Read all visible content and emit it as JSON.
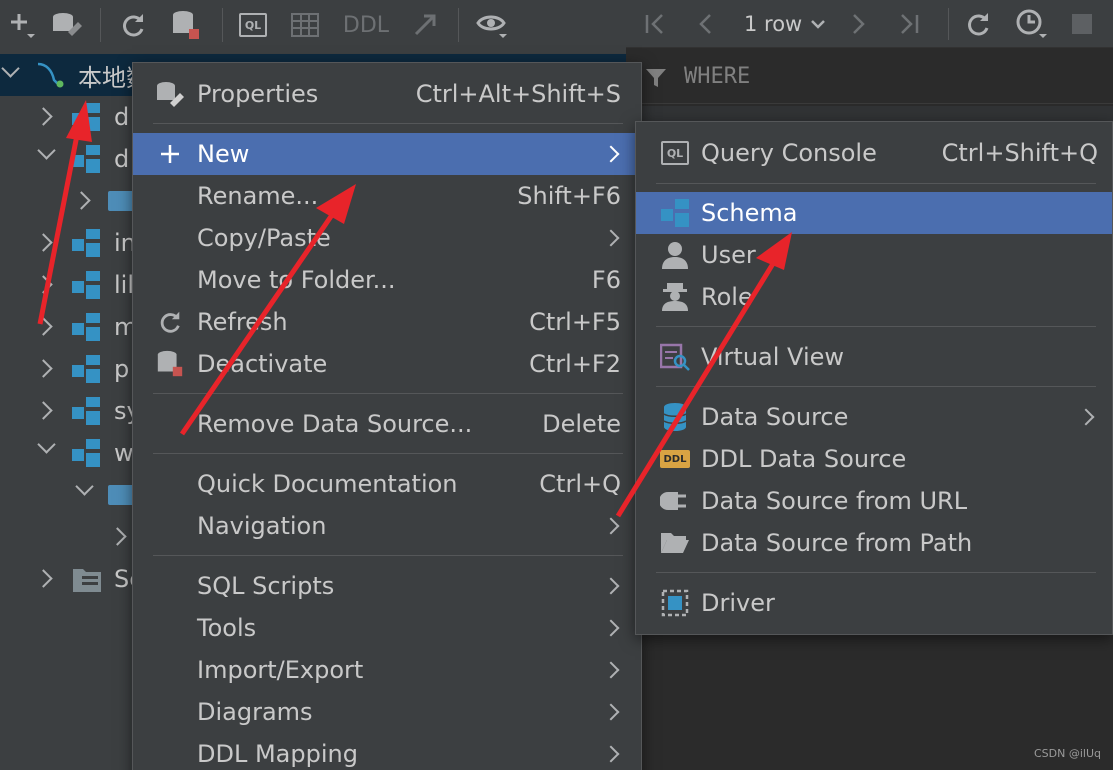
{
  "left_toolbar": {
    "ddl_label": "DDL"
  },
  "right_toolbar": {
    "rows_label": "1 row"
  },
  "filter": {
    "where_label": "WHERE"
  },
  "tree": {
    "root_label": "本地数",
    "rows": [
      {
        "label": "d"
      },
      {
        "label": "d"
      },
      {
        "label": ""
      },
      {
        "label": "in"
      },
      {
        "label": "lil"
      },
      {
        "label": "m"
      },
      {
        "label": "p"
      },
      {
        "label": "sy"
      },
      {
        "label": "w"
      },
      {
        "label": ""
      },
      {
        "label": ""
      },
      {
        "label": "Se"
      }
    ]
  },
  "context_menu": {
    "items": [
      {
        "label": "Properties",
        "shortcut": "Ctrl+Alt+Shift+S"
      },
      {
        "label": "New",
        "shortcut": ""
      },
      {
        "label": "Rename...",
        "shortcut": "Shift+F6"
      },
      {
        "label": "Copy/Paste",
        "shortcut": ""
      },
      {
        "label": "Move to Folder...",
        "shortcut": "F6"
      },
      {
        "label": "Refresh",
        "shortcut": "Ctrl+F5"
      },
      {
        "label": "Deactivate",
        "shortcut": "Ctrl+F2"
      },
      {
        "label": "Remove Data Source...",
        "shortcut": "Delete"
      },
      {
        "label": "Quick Documentation",
        "shortcut": "Ctrl+Q"
      },
      {
        "label": "Navigation",
        "shortcut": ""
      },
      {
        "label": "SQL Scripts",
        "shortcut": ""
      },
      {
        "label": "Tools",
        "shortcut": ""
      },
      {
        "label": "Import/Export",
        "shortcut": ""
      },
      {
        "label": "Diagrams",
        "shortcut": ""
      },
      {
        "label": "DDL Mapping",
        "shortcut": ""
      }
    ]
  },
  "submenu": {
    "items": [
      {
        "label": "Query Console",
        "shortcut": "Ctrl+Shift+Q"
      },
      {
        "label": "Schema",
        "shortcut": ""
      },
      {
        "label": "User",
        "shortcut": ""
      },
      {
        "label": "Role",
        "shortcut": ""
      },
      {
        "label": "Virtual View",
        "shortcut": ""
      },
      {
        "label": "Data Source",
        "shortcut": ""
      },
      {
        "label": "DDL Data Source",
        "shortcut": ""
      },
      {
        "label": "Data Source from URL",
        "shortcut": ""
      },
      {
        "label": "Data Source from Path",
        "shortcut": ""
      },
      {
        "label": "Driver",
        "shortcut": ""
      }
    ],
    "icon_labels": {
      "ql": "QL",
      "ddl": "DDL"
    }
  },
  "colors": {
    "highlight": "#4b6eaf",
    "annotation_arrow": "#e8242a",
    "schema_icon": "#3592c4"
  },
  "watermark": "CSDN @ilUq"
}
